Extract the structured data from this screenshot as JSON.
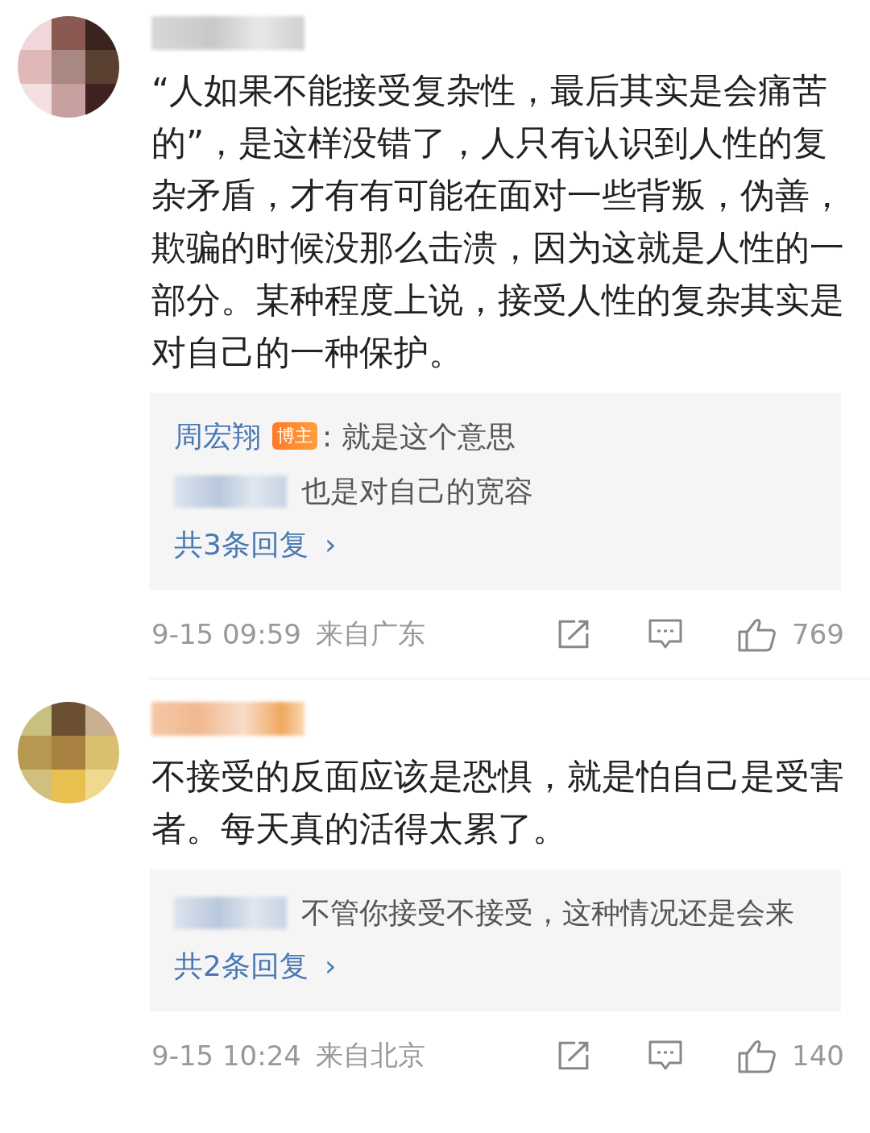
{
  "comments": [
    {
      "text": "“人如果不能接受复杂性，最后其实是会痛苦的”，是这样没错了，人只有认识到人性的复杂矛盾，才有有可能在面对一些背叛，伪善，欺骗的时候没那么击溃，因为这就是人性的一部分。某种程度上说，接受人性的复杂其实是对自己的一种保护。",
      "replies": [
        {
          "author": "周宏翔",
          "badge": "博主",
          "text": ": 就是这个意思"
        },
        {
          "text": "也是对自己的宽容"
        }
      ],
      "more_replies": "共3条回复",
      "more_icon": "›",
      "time": "9-15 09:59",
      "location": "来自广东",
      "likes": "769"
    },
    {
      "text": "不接受的反面应该是恐惧，就是怕自己是受害者。每天真的活得太累了。",
      "replies": [
        {
          "text": "不管你接受不接受，这种情况还是会来"
        }
      ],
      "more_replies": "共2条回复",
      "more_icon": "›",
      "time": "9-15 10:24",
      "location": "来自北京",
      "likes": "140"
    }
  ]
}
